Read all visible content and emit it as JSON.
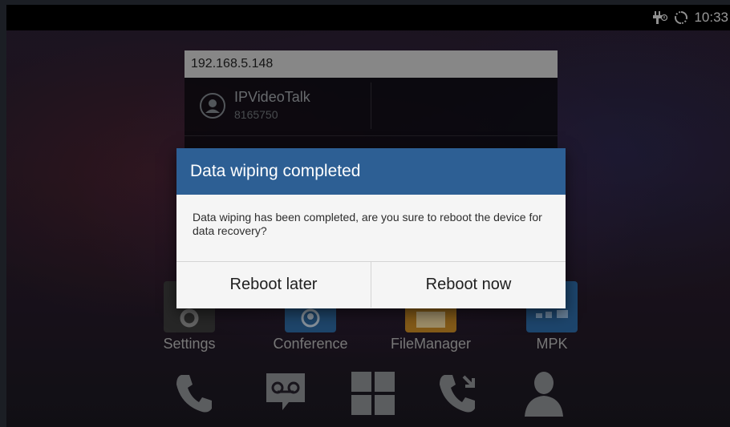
{
  "status_bar": {
    "time": "10:33"
  },
  "widget": {
    "header": "192.168.5.148",
    "contact_name": "IPVideoTalk",
    "contact_number": "8165750"
  },
  "apps": [
    {
      "label": "Settings",
      "color": "#3d3d3d"
    },
    {
      "label": "Conference",
      "color": "#2e6aa3"
    },
    {
      "label": "FileManager",
      "color": "#c98b26"
    },
    {
      "label": "MPK",
      "color": "#2d6aa6"
    }
  ],
  "dock": [
    "phone-icon",
    "voicemail-icon",
    "apps-grid-icon",
    "call-history-icon",
    "contacts-icon"
  ],
  "dialog": {
    "title": "Data wiping completed",
    "message": "Data wiping has been completed, are you sure to reboot the device for data recovery?",
    "buttons": {
      "later": "Reboot later",
      "now": "Reboot now"
    }
  },
  "colors": {
    "dialog_header": "#2d5f94",
    "dialog_bg": "#f5f5f5"
  }
}
